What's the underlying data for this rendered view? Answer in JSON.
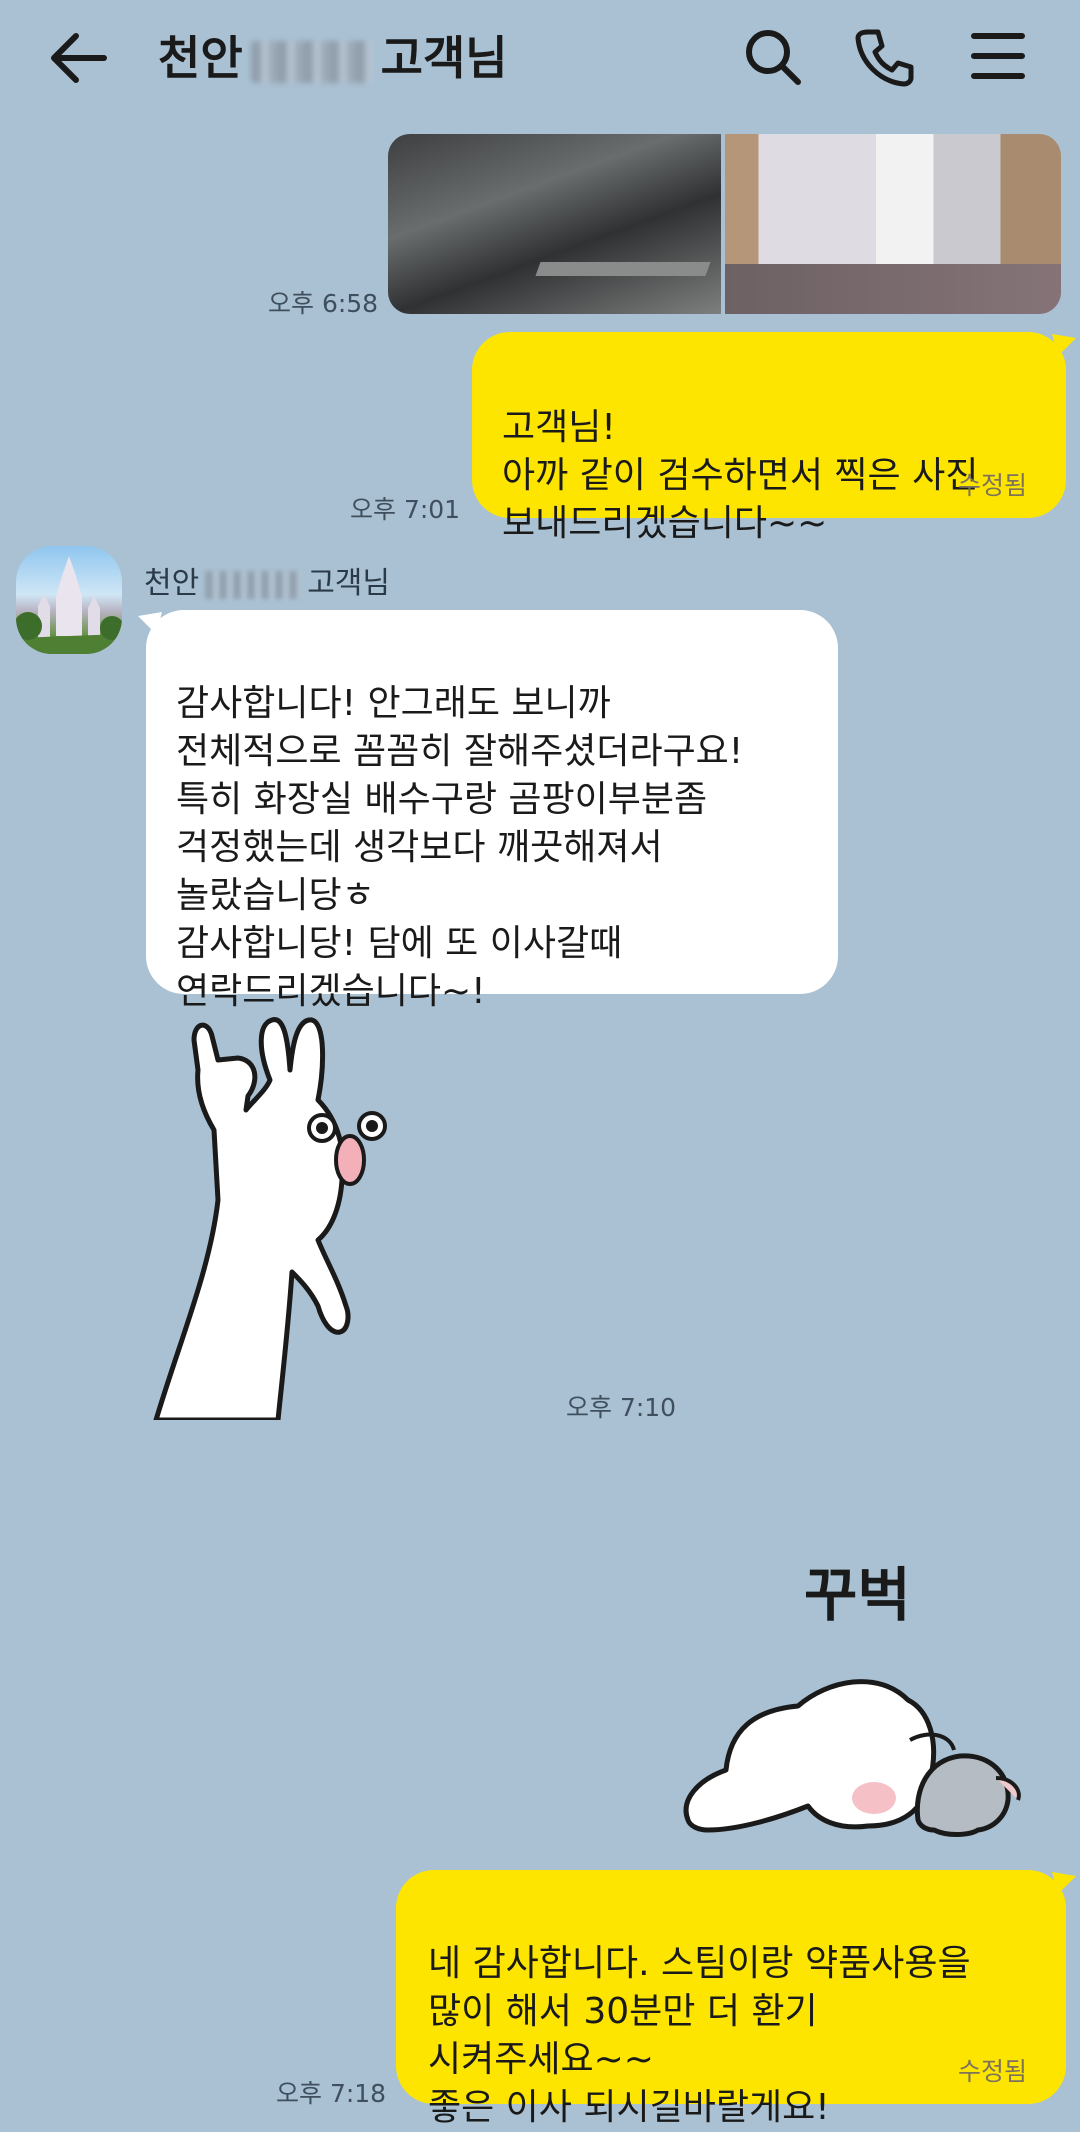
{
  "colors": {
    "background": "#a9c1d3",
    "my_bubble": "#fee500",
    "their_bubble": "#ffffff"
  },
  "header": {
    "title_prefix": "천안",
    "title_suffix": "고객님",
    "icons": [
      "back-arrow-icon",
      "search-icon",
      "phone-icon",
      "menu-icon"
    ]
  },
  "messages": {
    "photos_time": "오후 6:58",
    "msg1": {
      "text": "고객님!\n아까 같이 검수하면서 찍은 사진\n보내드리겠습니다~~",
      "time": "오후 7:01",
      "edited": "수정됨"
    },
    "incoming": {
      "sender_prefix": "천안",
      "sender_suffix": "고객님",
      "text": "감사합니다! 안그래도 보니까\n전체적으로 꼼꼼히 잘해주셨더라구요!\n특히 화장실 배수구랑 곰팡이부분좀\n걱정했는데 생각보다 깨끗해져서\n놀랐습니당ㅎ\n감사합니당! 담에 또 이사갈때\n연락드리겠습니다~!",
      "time": "오후 7:10"
    },
    "bow_sticker_text": "꾸벅",
    "msg2": {
      "text": "네 감사합니다. 스팀이랑 약품사용을\n많이 해서 30분만 더 환기\n시켜주세요~~\n좋은 이사 되시길바랄게요!",
      "time": "오후 7:18",
      "edited": "수정됨"
    }
  }
}
